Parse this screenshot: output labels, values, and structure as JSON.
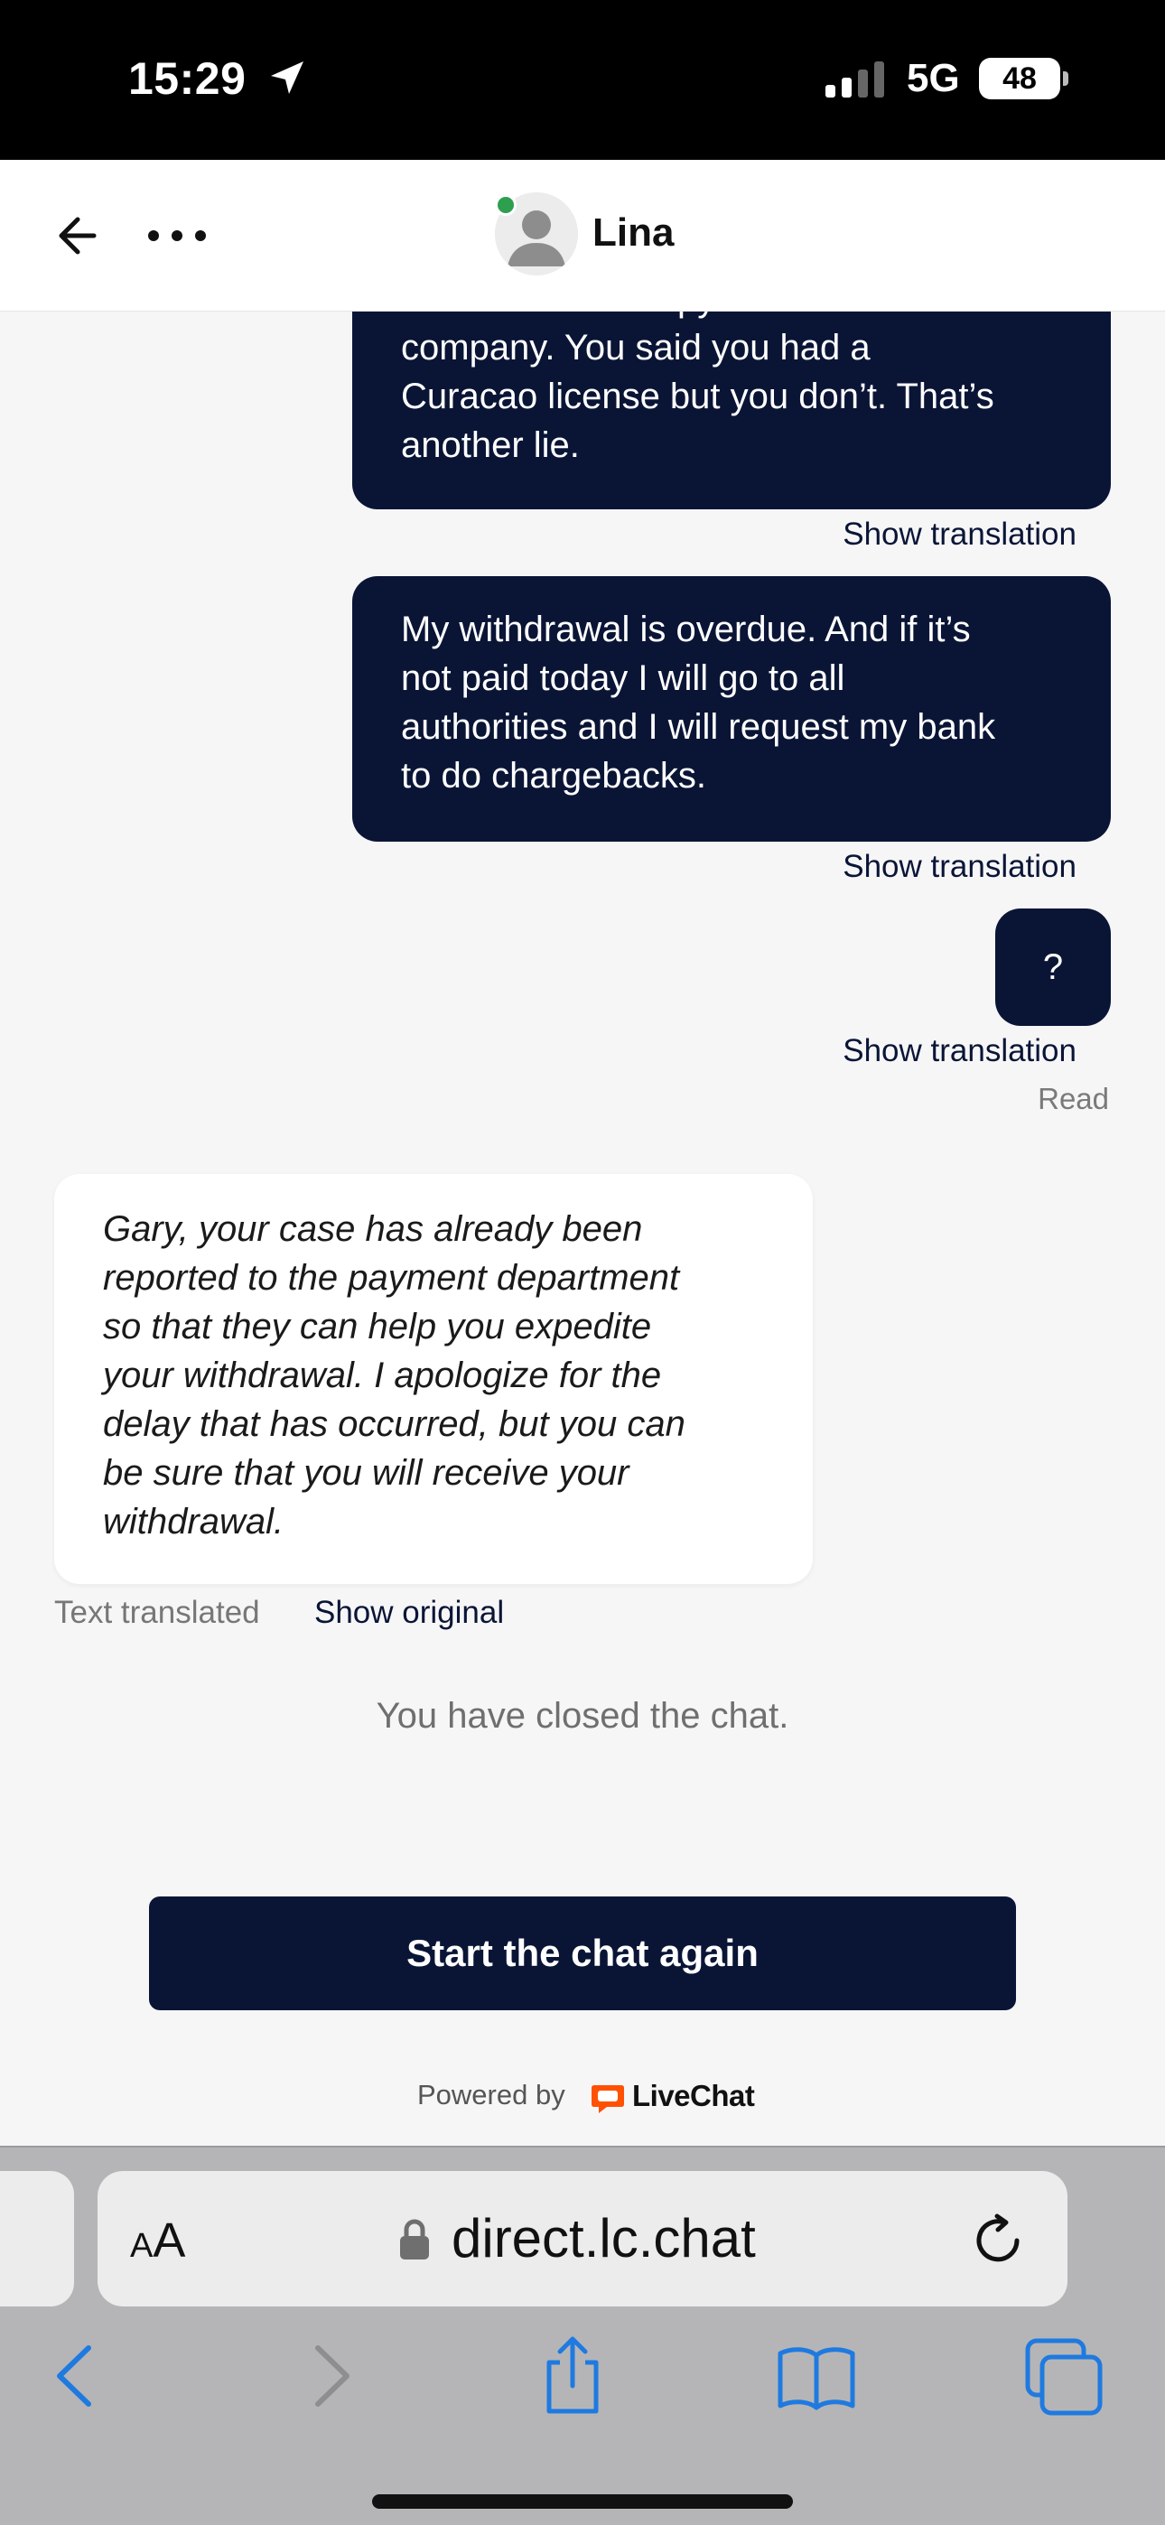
{
  "status_bar": {
    "time": "15:29",
    "network": "5G",
    "battery": "48"
  },
  "header": {
    "agent_name": "Lina",
    "online": true
  },
  "messages": {
    "outgoing": [
      {
        "lines": [
          "it is fake. It’s a copy from a UK",
          "company. You said you had a",
          "Curacao license but you don’t. That’s",
          "another lie."
        ],
        "show_translation": "Show translation"
      },
      {
        "lines": [
          "My withdrawal is overdue. And if it’s",
          "not paid today I will go to all",
          "authorities and I will request my bank",
          "to do chargebacks."
        ],
        "show_translation": "Show translation"
      },
      {
        "lines": [
          "?"
        ],
        "show_translation": "Show translation"
      }
    ],
    "read_status": "Read",
    "incoming": {
      "lines": [
        "Gary, your case has already been",
        "reported to the payment department",
        "so that they can help you expedite",
        "your withdrawal. I apologize for the",
        "delay that has occurred, but you can",
        "be sure that you will receive your",
        "withdrawal."
      ],
      "translated_note": "Text translated",
      "show_original": "Show original"
    }
  },
  "closed_message": "You have closed the chat.",
  "restart_button": "Start the chat again",
  "powered_by": {
    "label": "Powered by",
    "brand": "LiveChat",
    "brand_color": "#ff5100"
  },
  "browser": {
    "text_size_label_small": "A",
    "text_size_label_large": "A",
    "url": "direct.lc.chat",
    "accent": "#1f7ae0"
  },
  "colors": {
    "primary_dark": "#0a1536",
    "online_green": "#2e9e4f",
    "background": "#f6f6f7"
  }
}
